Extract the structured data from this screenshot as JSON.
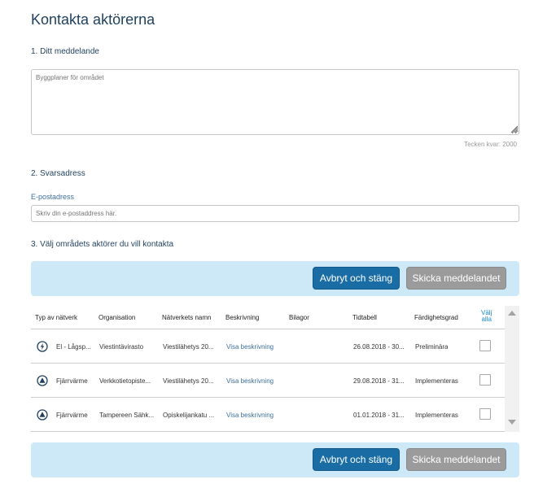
{
  "page": {
    "title": "Kontakta aktörerna"
  },
  "message": {
    "section_title": "1. Ditt meddelande",
    "placeholder": "Byggplaner för området",
    "chars_left": "Tecken kvar: 2000"
  },
  "reply": {
    "section_title": "2. Svarsadress",
    "email_label": "E-postadress",
    "email_placeholder": "Skriv din e-postaddress här."
  },
  "actors": {
    "section_title": "3. Välj områdets aktörer du vill kontakta"
  },
  "buttons": {
    "cancel_label": "Avbryt och stäng",
    "send_label": "Skicka meddelandet"
  },
  "table": {
    "headers": {
      "network_type": "Typ av nätverk",
      "organisation": "Organisation",
      "network_name": "Nätverkets namn",
      "description": "Beskrivning",
      "attachments": "Bilagor",
      "schedule": "Tidtabell",
      "readiness": "Färdighetsgrad",
      "select_all_1": "Välj",
      "select_all_2": "alla"
    },
    "rows": [
      {
        "icon": "lightning-icon",
        "network_type": "El - Lågsp...",
        "organisation": "Viestintävirasto",
        "network_name": "Viestilähetys 20...",
        "description": "Visa beskrivning",
        "attachments": "",
        "schedule": "26.08.2018 - 30...",
        "readiness": "Preliminära"
      },
      {
        "icon": "triangle-icon",
        "network_type": "Fjärrvärme",
        "organisation": "Verkkotietopiste...",
        "network_name": "Viestilähetys 20...",
        "description": "Visa beskrivning",
        "attachments": "",
        "schedule": "29.08.2018 - 31...",
        "readiness": "Implementeras"
      },
      {
        "icon": "triangle-icon",
        "network_type": "Fjärrvärme",
        "organisation": "Tampereen Sähk...",
        "network_name": "Opiskelijankatu ...",
        "description": "Visa beskrivning",
        "attachments": "",
        "schedule": "01.01.2018 - 31...",
        "readiness": "Implementeras"
      }
    ]
  },
  "colors": {
    "title": "#1e3f5e",
    "accent": "#1a6da4",
    "action_bar": "#cde9f8",
    "disabled_button": "#9b9b9b",
    "link": "#3d6f99"
  }
}
